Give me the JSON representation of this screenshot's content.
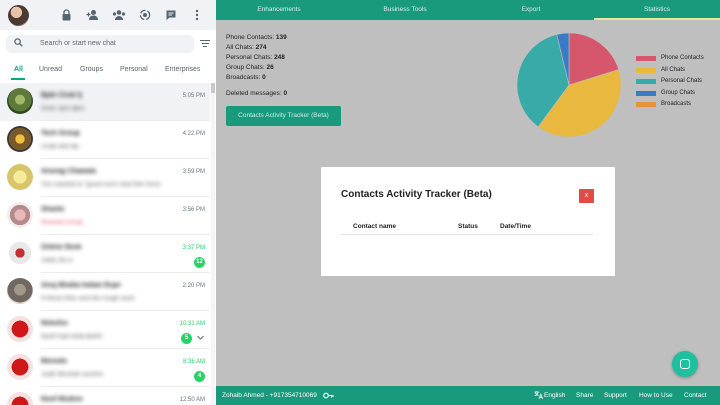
{
  "sidebar": {
    "search_placeholder": "Search or start new chat",
    "tabs": [
      "All",
      "Unread",
      "Groups",
      "Personal",
      "Enterprises"
    ],
    "chats": [
      {
        "name": "Bjdn Cnsk fj",
        "msg": "Nnds sjkd djksl",
        "time": "5:05 PM",
        "badge": ""
      },
      {
        "name": "Tech Group",
        "msg": "Lhsjd akd djs",
        "time": "4:22 PM",
        "badge": ""
      },
      {
        "name": "Anurag Chawala",
        "msg": "You reacted to \"good morn skat bhn hmnn\"",
        "time": "3:59 PM",
        "badge": ""
      },
      {
        "name": "Shastu",
        "msg": "Reacted emoji",
        "time": "3:56 PM",
        "badge": ""
      },
      {
        "name": "Online Desk",
        "msg": "Jskld Jhs k",
        "time": "3:37 PM",
        "badge": "12"
      },
      {
        "name": "Anuj Bhatia Indian Express",
        "msg": "If these links and the rough work",
        "time": "2:20 PM",
        "badge": ""
      },
      {
        "name": "Nsksfss",
        "msg": "Kjsdl hsjd lskdj djskhl",
        "time": "10:31 AM",
        "badge": "5"
      },
      {
        "name": "Mxnsds",
        "msg": "Jsdkl Mnshdn wushm",
        "time": "8:36 AM",
        "badge": "4"
      },
      {
        "name": "Nsnf Msdnsi",
        "msg": "",
        "time": "12:50 AM",
        "badge": ""
      }
    ]
  },
  "nav": [
    "Enhancements",
    "Business Tools",
    "Export",
    "Statistics"
  ],
  "stats": [
    {
      "label": "Phone Contacts:",
      "value": "139"
    },
    {
      "label": "All Chats:",
      "value": "274"
    },
    {
      "label": "Personal Chats:",
      "value": "248"
    },
    {
      "label": "Group Chats:",
      "value": "26"
    },
    {
      "label": "Broadcasts:",
      "value": "0"
    }
  ],
  "deleted": {
    "label": "Deleted messages:",
    "value": "0"
  },
  "tracker_button": "Contacts Activity Tracker (Beta)",
  "chart_data": {
    "type": "pie",
    "categories": [
      "Phone Contacts",
      "All Chats",
      "Personal Chats",
      "Group Chats",
      "Broadcasts"
    ],
    "values": [
      139,
      274,
      248,
      26,
      0
    ],
    "colors": [
      "#d6566b",
      "#e8b83f",
      "#38aaa8",
      "#3a7bc8",
      "#e8923a"
    ],
    "legend": "right"
  },
  "modal": {
    "title": "Contacts Activity Tracker (Beta)",
    "close": "x",
    "headers": [
      "Contact name",
      "Status",
      "Date/Time"
    ]
  },
  "bottom": {
    "user": "Zohaib Ahmed - +917354710069",
    "language": "English",
    "links": [
      "Share",
      "Support",
      "How to Use",
      "Contact"
    ]
  }
}
